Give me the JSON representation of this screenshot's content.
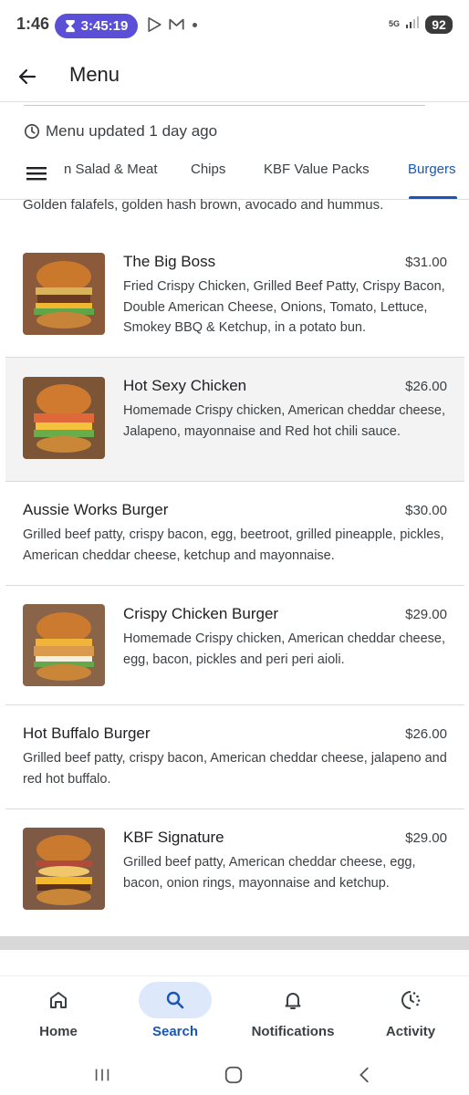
{
  "status_bar": {
    "time": "1:46",
    "timer": "3:45:19",
    "network": "5G",
    "battery": "92"
  },
  "appbar": {
    "title": "Menu"
  },
  "menu_updated": "Menu updated 1 day ago",
  "tabs": [
    {
      "label": "n Salad & Meat",
      "active": false
    },
    {
      "label": "Chips",
      "active": false
    },
    {
      "label": "KBF Value Packs",
      "active": false
    },
    {
      "label": "Burgers",
      "active": true
    }
  ],
  "cut_description": "Golden falafels, golden hash brown, avocado and hummus.",
  "items": [
    {
      "name": "The Big Boss",
      "price": "$31.00",
      "description": "Fried Crispy Chicken, Grilled Beef Patty, Crispy Bacon, Double American Cheese, Onions, Tomato, Lettuce, Smokey BBQ & Ketchup, in a potato bun."
    },
    {
      "name": "Hot Sexy Chicken",
      "price": "$26.00",
      "description": "Homemade Crispy chicken, American cheddar cheese, Jalapeno, mayonnaise and Red hot chili sauce."
    },
    {
      "name": "Aussie Works Burger",
      "price": "$30.00",
      "description": "Grilled beef patty, crispy bacon, egg, beetroot, grilled pineapple, pickles, American cheddar cheese, ketchup and mayonnaise."
    },
    {
      "name": "Crispy Chicken Burger",
      "price": "$29.00",
      "description": "Homemade Crispy chicken, American cheddar cheese, egg, bacon, pickles and peri peri aioli."
    },
    {
      "name": "Hot Buffalo Burger",
      "price": "$26.00",
      "description": "Grilled beef patty, crispy bacon, American cheddar cheese, jalapeno and red hot buffalo."
    },
    {
      "name": "KBF Signature",
      "price": "$29.00",
      "description": "Grilled beef patty, American cheddar cheese, egg, bacon, onion rings, mayonnaise and ketchup."
    }
  ],
  "bottom_nav": [
    {
      "label": "Home",
      "icon": "home-icon",
      "active": false
    },
    {
      "label": "Search",
      "icon": "search-icon",
      "active": true
    },
    {
      "label": "Notifications",
      "icon": "bell-icon",
      "active": false
    },
    {
      "label": "Activity",
      "icon": "activity-icon",
      "active": false
    }
  ],
  "colors": {
    "accent": "#1a56b8",
    "timer_pill": "#5a4fd6",
    "nav_active_bg": "#dde8fb"
  }
}
